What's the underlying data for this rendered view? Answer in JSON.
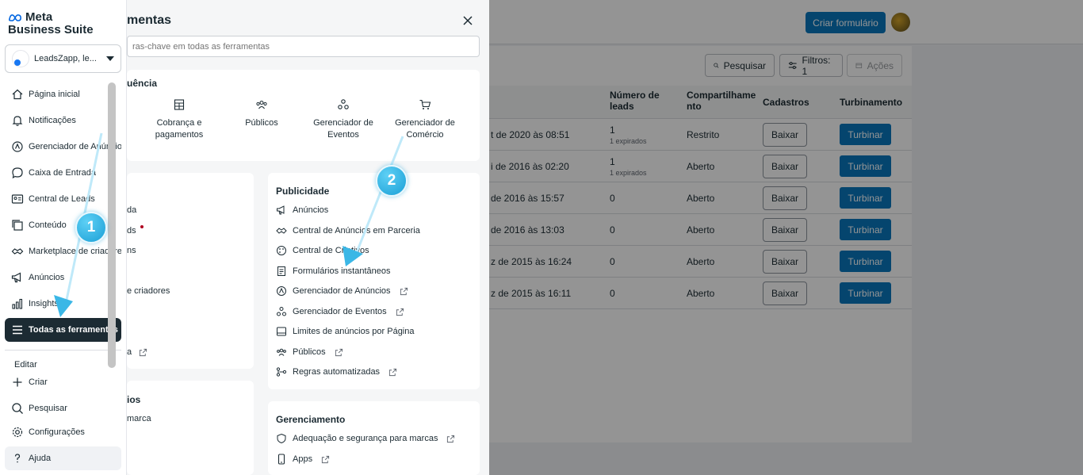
{
  "background": {
    "create_form": "Criar formulário",
    "toolbar": {
      "search": "Pesquisar",
      "filters": "Filtros: 1",
      "actions": "Ações"
    },
    "columns": {
      "leads": "Número de leads",
      "sharing": "Compartilhamento",
      "registrations": "Cadastros",
      "boost": "Turbinamento"
    },
    "rows": [
      {
        "date": "t de 2020 às 08:51",
        "leads": "1",
        "expired": "1 expirados",
        "sharing": "Restrito",
        "download": "Baixar",
        "boost": "Turbinar"
      },
      {
        "date": "i de 2016 às 02:20",
        "leads": "1",
        "expired": "1 expirados",
        "sharing": "Aberto",
        "download": "Baixar",
        "boost": "Turbinar"
      },
      {
        "date": "de 2016 às 15:57",
        "leads": "0",
        "expired": "",
        "sharing": "Aberto",
        "download": "Baixar",
        "boost": "Turbinar"
      },
      {
        "date": "de 2016 às 13:03",
        "leads": "0",
        "expired": "",
        "sharing": "Aberto",
        "download": "Baixar",
        "boost": "Turbinar"
      },
      {
        "date": "z de 2015 às 16:24",
        "leads": "0",
        "expired": "",
        "sharing": "Aberto",
        "download": "Baixar",
        "boost": "Turbinar"
      },
      {
        "date": "z de 2015 às 16:11",
        "leads": "0",
        "expired": "",
        "sharing": "Aberto",
        "download": "Baixar",
        "boost": "Turbinar"
      }
    ]
  },
  "sidebar": {
    "logo_line1": "Meta",
    "logo_line2": "Business Suite",
    "account": "LeadsZapp, le...",
    "items": [
      {
        "label": "Página inicial",
        "icon": "home-icon"
      },
      {
        "label": "Notificações",
        "icon": "bell-icon"
      },
      {
        "label": "Gerenciador de Anúncios",
        "icon": "ads-manager-icon"
      },
      {
        "label": "Caixa de Entrada",
        "icon": "chat-icon"
      },
      {
        "label": "Central de Leads",
        "icon": "leads-icon"
      },
      {
        "label": "Conteúdo",
        "icon": "content-icon"
      },
      {
        "label": "Marketplace de criadores",
        "icon": "marketplace-icon"
      },
      {
        "label": "Anúncios",
        "icon": "megaphone-icon"
      },
      {
        "label": "Insights",
        "icon": "insights-icon"
      },
      {
        "label": "Todas as ferramentas",
        "icon": "menu-icon"
      }
    ],
    "edit_label": "Editar",
    "create": "Criar",
    "search": "Pesquisar",
    "settings": "Configurações",
    "help": "Ajuda"
  },
  "panel": {
    "title": "mentas",
    "search_placeholder": "ras-chave em todas as ferramentas",
    "frequent_title": "uência",
    "frequent": [
      {
        "label": "Cobrança e pagamentos",
        "icon": "billing-icon"
      },
      {
        "label": "Públicos",
        "icon": "audiences-icon"
      },
      {
        "label": "Gerenciador de Eventos",
        "icon": "events-icon"
      },
      {
        "label": "Gerenciador de Comércio",
        "icon": "cart-icon"
      }
    ],
    "left_fragments": [
      "da",
      "ds",
      "ns",
      "e criadores",
      "a"
    ],
    "left_lower_fragments": [
      "ios",
      "marca"
    ],
    "advertising": {
      "title": "Publicidade",
      "items": [
        {
          "label": "Anúncios",
          "icon": "megaphone-icon",
          "external": false
        },
        {
          "label": "Central de Anúncios em Parceria",
          "icon": "partnership-icon",
          "external": false
        },
        {
          "label": "Central de Criativos",
          "icon": "palette-icon",
          "external": false
        },
        {
          "label": "Formulários instantâneos",
          "icon": "form-icon",
          "external": false
        },
        {
          "label": "Gerenciador de Anúncios",
          "icon": "ads-manager-icon",
          "external": true
        },
        {
          "label": "Gerenciador de Eventos",
          "icon": "events-icon",
          "external": true
        },
        {
          "label": "Limites de anúncios por Página",
          "icon": "limits-icon",
          "external": false
        },
        {
          "label": "Públicos",
          "icon": "audiences-icon",
          "external": true
        },
        {
          "label": "Regras automatizadas",
          "icon": "rules-icon",
          "external": true
        }
      ]
    },
    "management": {
      "title": "Gerenciamento",
      "items": [
        {
          "label": "Adequação e segurança para marcas",
          "icon": "shield-icon",
          "external": true
        },
        {
          "label": "Apps",
          "icon": "phone-icon",
          "external": true
        }
      ]
    }
  },
  "callouts": [
    "1",
    "2"
  ]
}
